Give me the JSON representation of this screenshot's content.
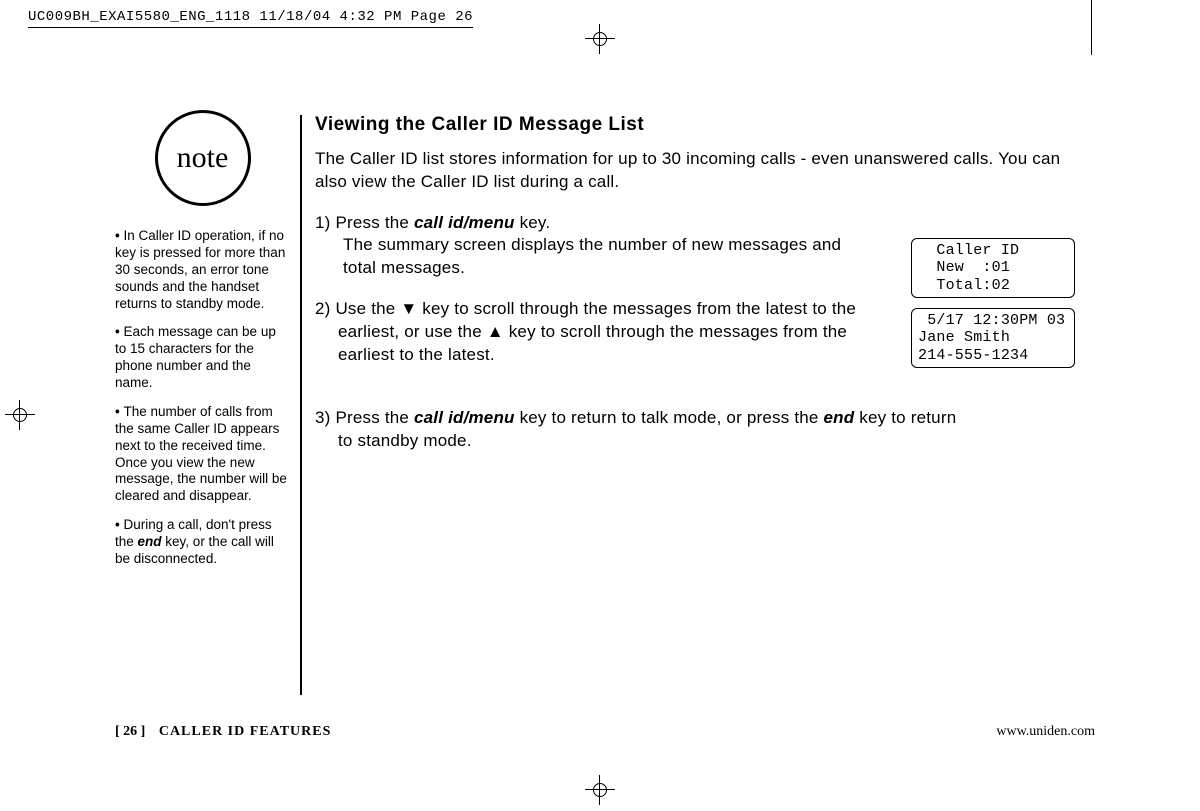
{
  "prepress": "UC009BH_EXAI5580_ENG_1118  11/18/04  4:32 PM  Page 26",
  "sidebar": {
    "note_label": "note",
    "bullets": [
      "In Caller ID operation, if no key is pressed for more than 30 seconds, an error tone sounds and the handset returns to standby mode.",
      "Each message can be up to 15 characters for the phone number and the name.",
      "The number of calls from the same Caller ID appears next to the received time. Once you view the new message, the number will be cleared and disappear.",
      "During a call, don't press the <b>end</b> key, or the call will be disconnected."
    ]
  },
  "main": {
    "heading": "Viewing the Caller ID Message List",
    "intro": "The Caller ID list stores information for up to 30 incoming calls - even unanswered calls. You can also view the Caller ID list during a call.",
    "step1_a": "1) Press the ",
    "step1_key": "call id/menu",
    "step1_b": " key.",
    "step1_sub": "The summary screen displays the number of new messages and total messages.",
    "step2": "2) Use the ▼ key to scroll through the messages from the latest to the earliest, or use the ▲ key to scroll through the messages from the earliest to the latest.",
    "step3_a": "3) Press the ",
    "step3_key1": "call id/menu",
    "step3_b": " key to return to talk mode, or press the ",
    "step3_key2": "end",
    "step3_c": " key to return to standby mode."
  },
  "lcd1": "  Caller ID\n  New  :01\n  Total:02",
  "lcd2": " 5/17 12:30PM 03\nJane Smith\n214-555-1234",
  "footer": {
    "page_num": "[ 26 ]",
    "section": "CALLER ID FEATURES",
    "url": "www.uniden.com"
  }
}
